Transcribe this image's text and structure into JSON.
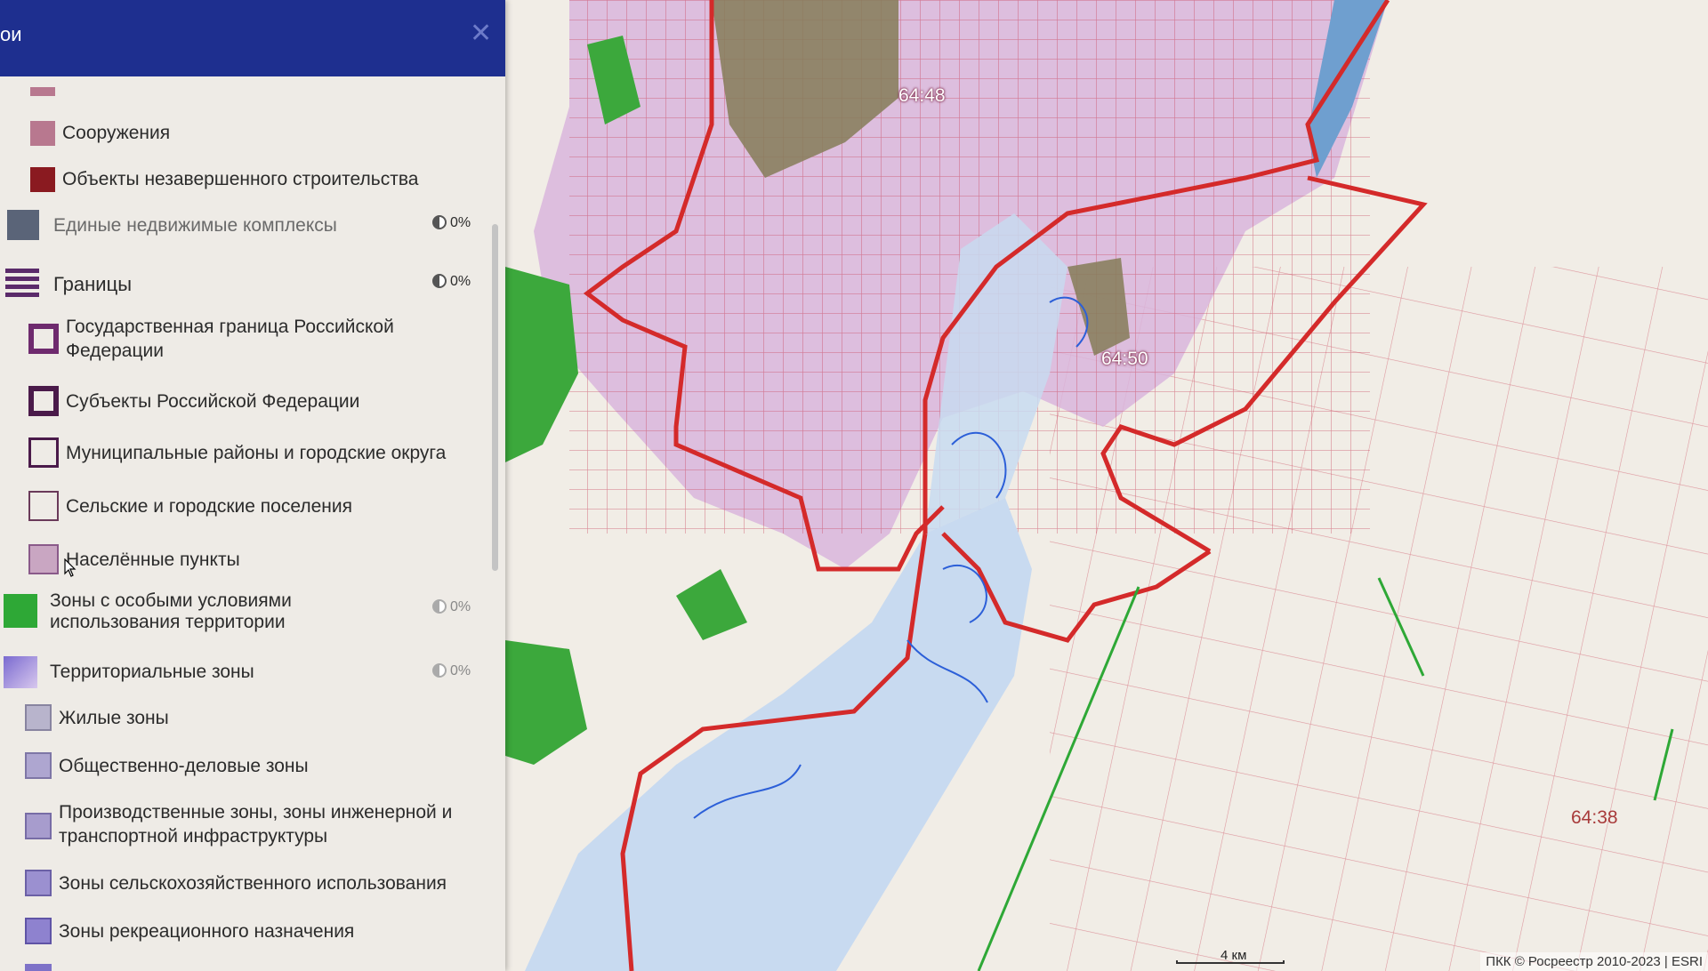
{
  "panel": {
    "title": "ои",
    "close_icon": "close-icon",
    "collapse_icon": "chevron-left-icon",
    "items": [
      {
        "label": "Сооружения",
        "color": "#b8788f"
      },
      {
        "label": "Объекты незавершенного строительства",
        "color": "#8a1a20"
      },
      {
        "label": "Единые недвижимые комплексы",
        "color": "#5a6478",
        "opacity": "0%"
      },
      {
        "label": "Границы",
        "opacity": "0%"
      },
      {
        "label": "Государственная граница Российской Федерации"
      },
      {
        "label": "Субъекты Российской Федерации"
      },
      {
        "label": "Муниципальные районы и городские округа"
      },
      {
        "label": "Сельские и городские поселения"
      },
      {
        "label": "Населённые пункты",
        "color": "#c9a6c2"
      },
      {
        "label": "Зоны с особыми условиями использования территории",
        "color": "#2ea836",
        "opacity": "0%"
      },
      {
        "label": "Территориальные зоны",
        "opacity": "0%"
      },
      {
        "label": "Жилые зоны",
        "color": "#b8b4cc"
      },
      {
        "label": "Общественно-деловые зоны",
        "color": "#aea6d0"
      },
      {
        "label": "Производственные зоны, зоны инженерной и транспортной инфраструктуры",
        "color": "#a79ccd"
      },
      {
        "label": "Зоны сельскохозяйственного использования",
        "color": "#9b90d0"
      },
      {
        "label": "Зоны рекреационного назначения",
        "color": "#8e82cf"
      }
    ]
  },
  "map": {
    "labels": [
      "64:48",
      "64:50",
      "64:38"
    ],
    "scale_label": "4 км",
    "attribution": "ПКК © Росреестр 2010-2023 | ESRI"
  },
  "colors": {
    "header": "#1e2f8f",
    "boundary": "#d42a2a",
    "parcel": "#c8405a",
    "water": "#c8daf0",
    "forest": "#3ca83c",
    "urban": "#d9b5dc"
  }
}
